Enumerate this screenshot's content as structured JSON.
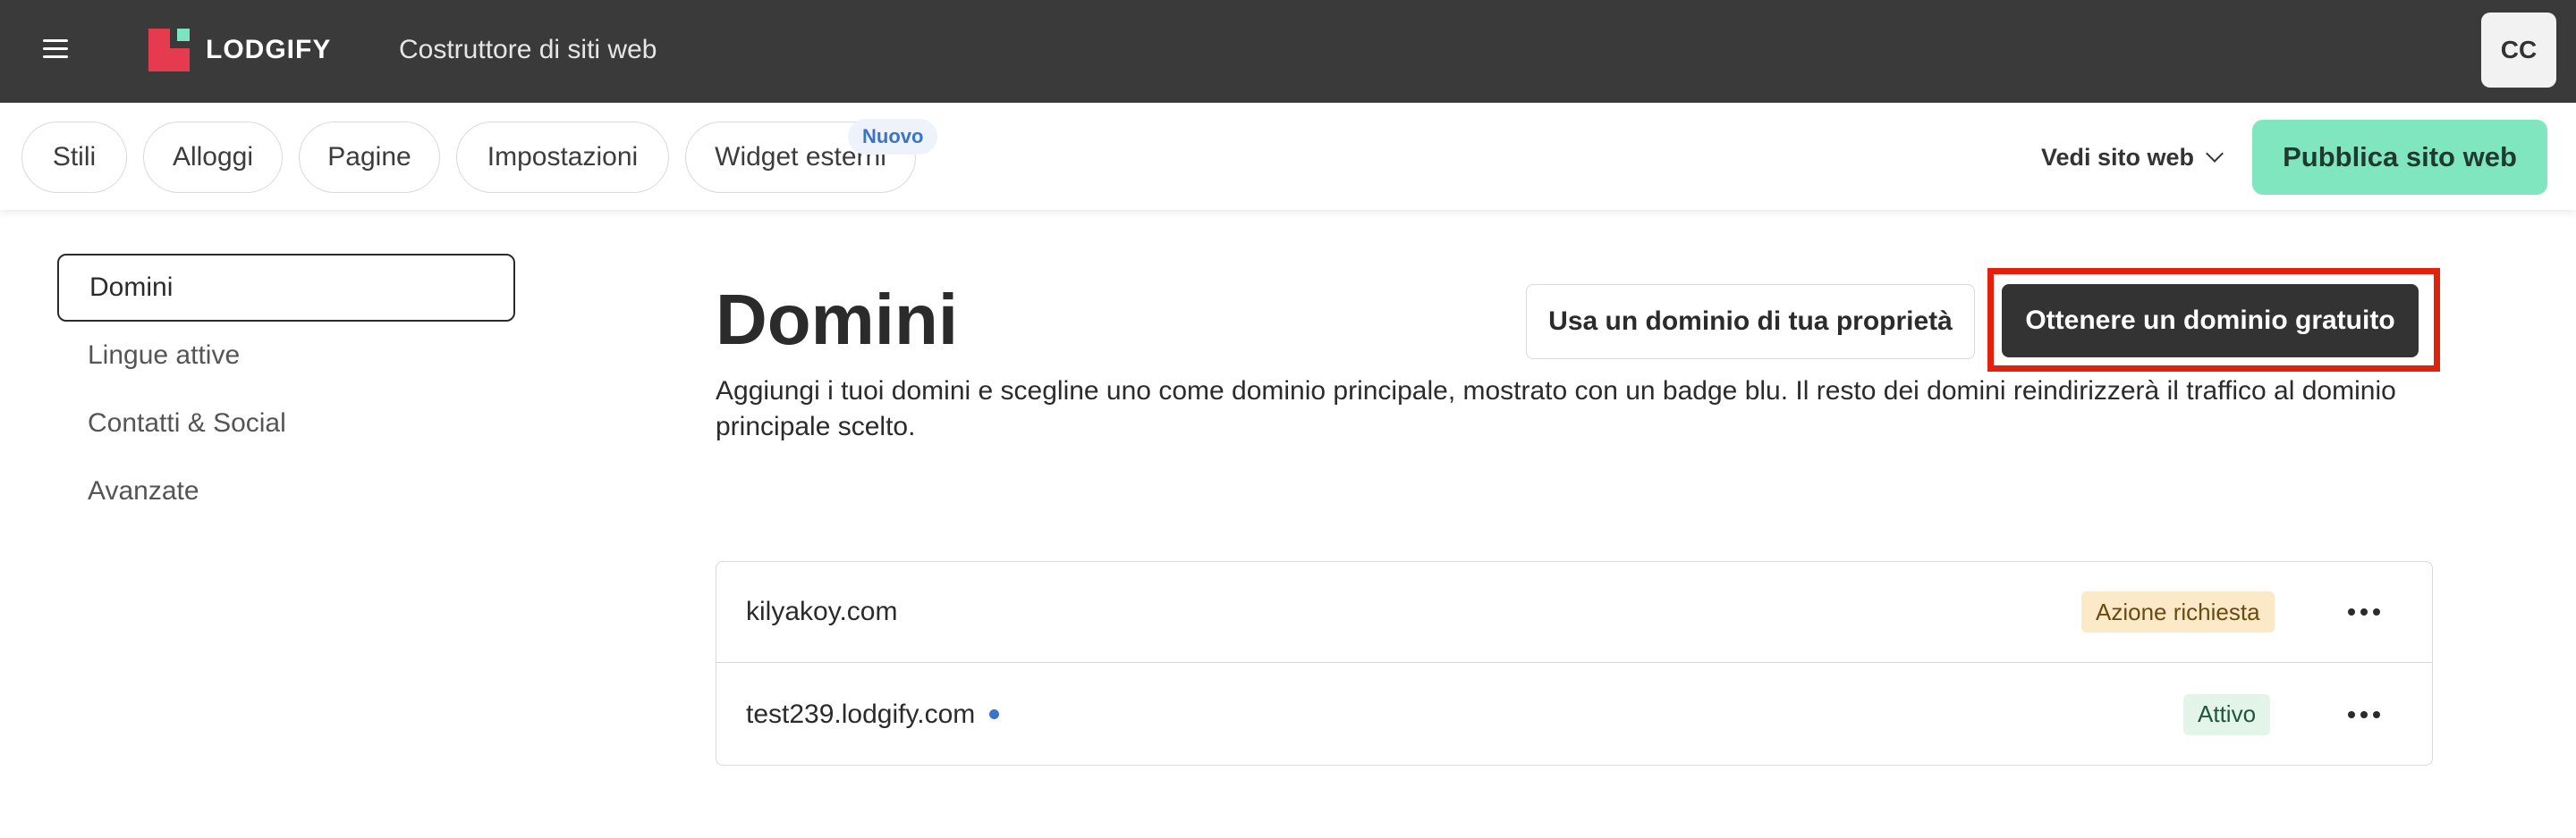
{
  "header": {
    "brand": "LODGIFY",
    "app_title": "Costruttore di siti web",
    "avatar_initials": "CC"
  },
  "toolbar": {
    "tabs": [
      {
        "label": "Stili"
      },
      {
        "label": "Alloggi"
      },
      {
        "label": "Pagine"
      },
      {
        "label": "Impostazioni"
      },
      {
        "label": "Widget esterni"
      }
    ],
    "new_badge": "Nuovo",
    "view_site_label": "Vedi sito web",
    "publish_label": "Pubblica sito web"
  },
  "sidebar": {
    "items": [
      {
        "label": "Domini"
      },
      {
        "label": "Lingue attive"
      },
      {
        "label": "Contatti & Social"
      },
      {
        "label": "Avanzate"
      }
    ]
  },
  "main": {
    "title": "Domini",
    "own_domain_label": "Usa un dominio di tua proprietà",
    "free_domain_label": "Ottenere un dominio gratuito",
    "description": "Aggiungi i tuoi domini e scegline uno come dominio principale, mostrato con un badge blu. Il resto dei domini reindirizzerà il traffico al dominio principale scelto.",
    "domains": [
      {
        "name": "kilyakoy.com",
        "status": "Azione richiesta"
      },
      {
        "name": "test239.lodgify.com",
        "status": "Attivo"
      }
    ]
  },
  "colors": {
    "topbar": "#3a3a3a",
    "accent_green": "#80e6c0",
    "primary_dark": "#333333",
    "highlight_red": "#e0220c",
    "primary_dot_blue": "#3b73c9"
  }
}
